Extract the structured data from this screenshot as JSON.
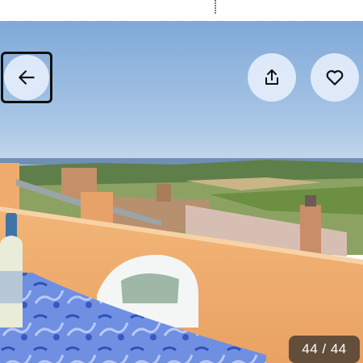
{
  "gallery": {
    "photo_alt": "",
    "counter": "44 / 44",
    "back_icon": "arrow-left-icon",
    "share_icon": "share-icon",
    "favorite_icon": "heart-icon"
  },
  "colors": {
    "button_bg": "#e1ecfa",
    "counter_bg": "#463a32",
    "icon": "#111111"
  }
}
